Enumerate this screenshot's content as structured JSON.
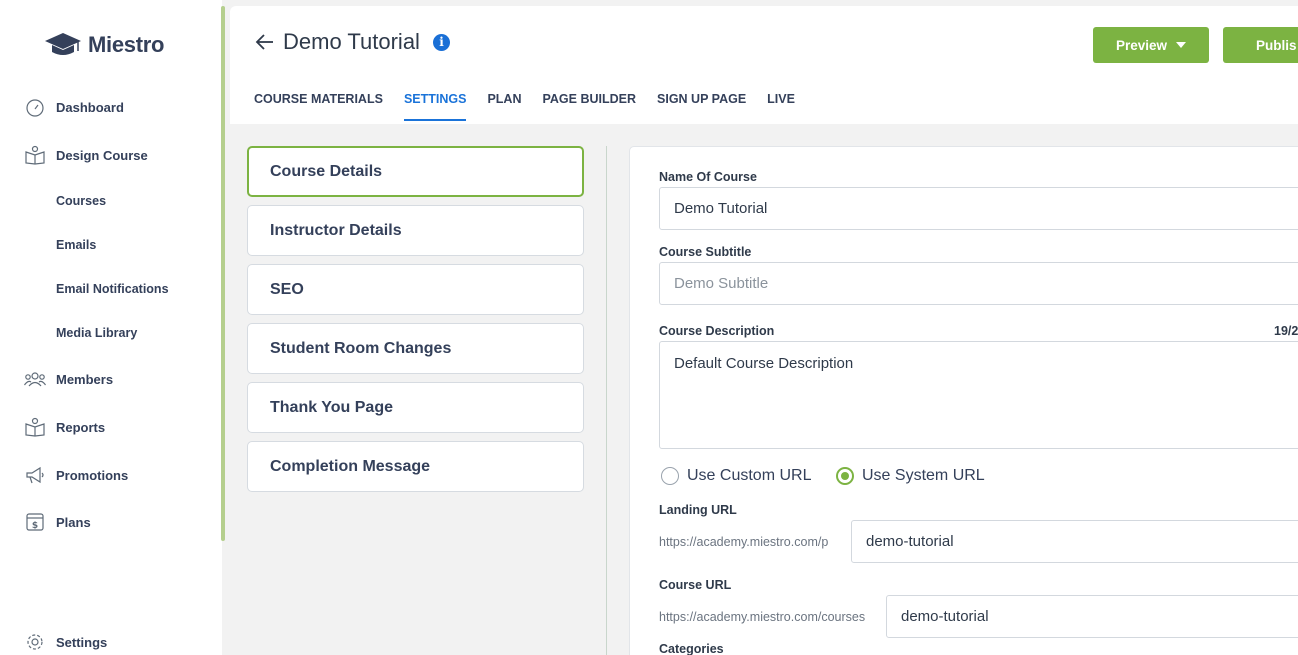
{
  "app": {
    "name": "Miestro"
  },
  "sidebar": {
    "items": [
      {
        "label": "Dashboard",
        "icon": "gauge-icon"
      },
      {
        "label": "Design Course",
        "icon": "open-book-icon"
      },
      {
        "label": "Courses"
      },
      {
        "label": "Emails"
      },
      {
        "label": "Email Notifications"
      },
      {
        "label": "Media Library"
      },
      {
        "label": "Members",
        "icon": "people-icon"
      },
      {
        "label": "Reports",
        "icon": "report-book-icon"
      },
      {
        "label": "Promotions",
        "icon": "megaphone-icon"
      },
      {
        "label": "Plans",
        "icon": "dollar-box-icon"
      },
      {
        "label": "Settings",
        "icon": "gear-icon"
      }
    ]
  },
  "header": {
    "title": "Demo Tutorial",
    "preview_label": "Preview",
    "publish_label": "Publis",
    "tabs": [
      {
        "label": "COURSE MATERIALS",
        "active": false
      },
      {
        "label": "SETTINGS",
        "active": true
      },
      {
        "label": "PLAN",
        "active": false
      },
      {
        "label": "PAGE BUILDER",
        "active": false
      },
      {
        "label": "SIGN UP PAGE",
        "active": false
      },
      {
        "label": "LIVE",
        "active": false
      }
    ]
  },
  "settings_menu": [
    {
      "label": "Course Details",
      "active": true
    },
    {
      "label": "Instructor Details",
      "active": false
    },
    {
      "label": "SEO",
      "active": false
    },
    {
      "label": "Student Room Changes",
      "active": false
    },
    {
      "label": "Thank You Page",
      "active": false
    },
    {
      "label": "Completion Message",
      "active": false
    }
  ],
  "form": {
    "name_label": "Name Of Course",
    "name_value": "Demo Tutorial",
    "subtitle_label": "Course Subtitle",
    "subtitle_placeholder": "Demo Subtitle",
    "description_label": "Course Description",
    "description_counter": "19/2",
    "description_value": "Default Course Description",
    "url_options": [
      {
        "label": "Use Custom URL",
        "checked": false
      },
      {
        "label": "Use System URL",
        "checked": true
      }
    ],
    "landing_label": "Landing URL",
    "landing_prefix": "https://academy.miestro.com/p",
    "landing_value": "demo-tutorial",
    "course_url_label": "Course URL",
    "course_url_prefix": "https://academy.miestro.com/courses",
    "course_url_value": "demo-tutorial",
    "categories_label": "Categories"
  },
  "colors": {
    "accent_green": "#7cb342",
    "active_blue": "#1a73d9",
    "info_blue": "#1a6fd6"
  }
}
